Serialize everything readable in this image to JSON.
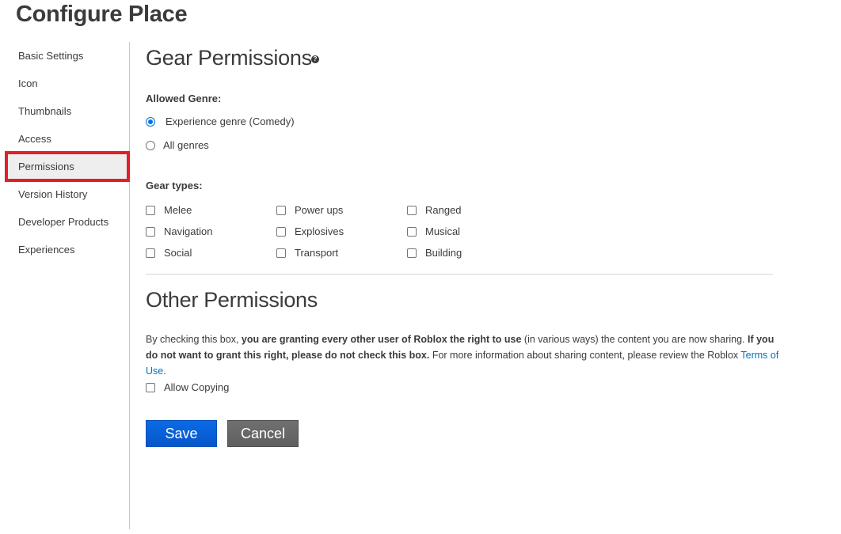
{
  "page": {
    "title": "Configure Place"
  },
  "sidebar": {
    "items": [
      {
        "label": "Basic Settings",
        "active": false
      },
      {
        "label": "Icon",
        "active": false
      },
      {
        "label": "Thumbnails",
        "active": false
      },
      {
        "label": "Access",
        "active": false
      },
      {
        "label": "Permissions",
        "active": true
      },
      {
        "label": "Version History",
        "active": false
      },
      {
        "label": "Developer Products",
        "active": false
      },
      {
        "label": "Experiences",
        "active": false
      }
    ]
  },
  "gear": {
    "heading": "Gear Permissions",
    "help_icon": "question-circle-icon",
    "allowed_genre_label": "Allowed Genre:",
    "genre_options": [
      {
        "label": "Experience genre (Comedy)",
        "selected": true
      },
      {
        "label": "All genres",
        "selected": false
      }
    ],
    "gear_types_label": "Gear types:",
    "gear_types": [
      {
        "label": "Melee",
        "checked": false
      },
      {
        "label": "Power ups",
        "checked": false
      },
      {
        "label": "Ranged",
        "checked": false
      },
      {
        "label": "Navigation",
        "checked": false
      },
      {
        "label": "Explosives",
        "checked": false
      },
      {
        "label": "Musical",
        "checked": false
      },
      {
        "label": "Social",
        "checked": false
      },
      {
        "label": "Transport",
        "checked": false
      },
      {
        "label": "Building",
        "checked": false
      }
    ]
  },
  "other": {
    "heading": "Other Permissions",
    "text_1": "By checking this box, ",
    "text_2_bold": "you are granting every other user of Roblox the right to use",
    "text_3": " (in various ways) the content you are now sharing. ",
    "text_4_bold": "If you do not want to grant this right, please do not check this box.",
    "text_5": " For more information about sharing content, please review the Roblox ",
    "terms_link": "Terms of Use",
    "text_6": ".",
    "allow_copying_label": "Allow Copying",
    "allow_copying_checked": false
  },
  "actions": {
    "save_label": "Save",
    "cancel_label": "Cancel"
  },
  "colors": {
    "accent": "#0074e8",
    "save_button": "#0a6be6",
    "highlight_outline": "#e41e26",
    "link": "#0074bd"
  }
}
